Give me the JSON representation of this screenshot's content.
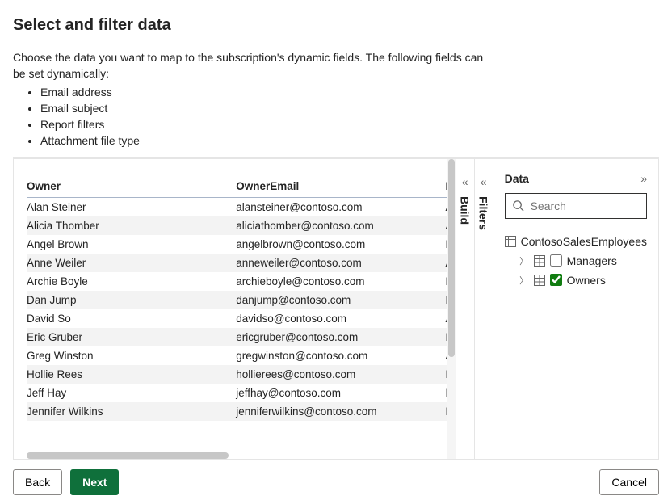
{
  "title": "Select and filter data",
  "intro": {
    "lead": "Choose the data you want to map to the subscription's dynamic fields. The following fields can be set dynamically:",
    "bullets": [
      "Email address",
      "Email subject",
      "Report filters",
      "Attachment file type"
    ]
  },
  "table": {
    "columns": [
      "Owner",
      "OwnerEmail",
      "Manager"
    ],
    "rows": [
      [
        "Alan Steiner",
        "alansteiner@contoso.com",
        "Amelie Garner"
      ],
      [
        "Alicia Thomber",
        "aliciathomber@contoso.com",
        "Amelie Garner"
      ],
      [
        "Angel Brown",
        "angelbrown@contoso.com",
        "Peyton Davis"
      ],
      [
        "Anne Weiler",
        "anneweiler@contoso.com",
        "Amelie Garner"
      ],
      [
        "Archie Boyle",
        "archieboyle@contoso.com",
        "Peyton Davis"
      ],
      [
        "Dan Jump",
        "danjump@contoso.com",
        "Ethan Brooks"
      ],
      [
        "David So",
        "davidso@contoso.com",
        "Amelie Garner"
      ],
      [
        "Eric Gruber",
        "ericgruber@contoso.com",
        "Ethan Brooks"
      ],
      [
        "Greg Winston",
        "gregwinston@contoso.com",
        "Amelie Garner"
      ],
      [
        "Hollie Rees",
        "hollierees@contoso.com",
        "Peyton Davis"
      ],
      [
        "Jeff Hay",
        "jeffhay@contoso.com",
        "Ethan Brooks"
      ],
      [
        "Jennifer Wilkins",
        "jenniferwilkins@contoso.com",
        "Peyton Davis"
      ]
    ]
  },
  "rails": {
    "build": "Build",
    "filters": "Filters"
  },
  "dataPanel": {
    "title": "Data",
    "search_placeholder": "Search",
    "dataset": "ContosoSalesEmployees",
    "tables": [
      {
        "name": "Managers",
        "checked": false
      },
      {
        "name": "Owners",
        "checked": true
      }
    ]
  },
  "footer": {
    "back": "Back",
    "next": "Next",
    "cancel": "Cancel"
  }
}
